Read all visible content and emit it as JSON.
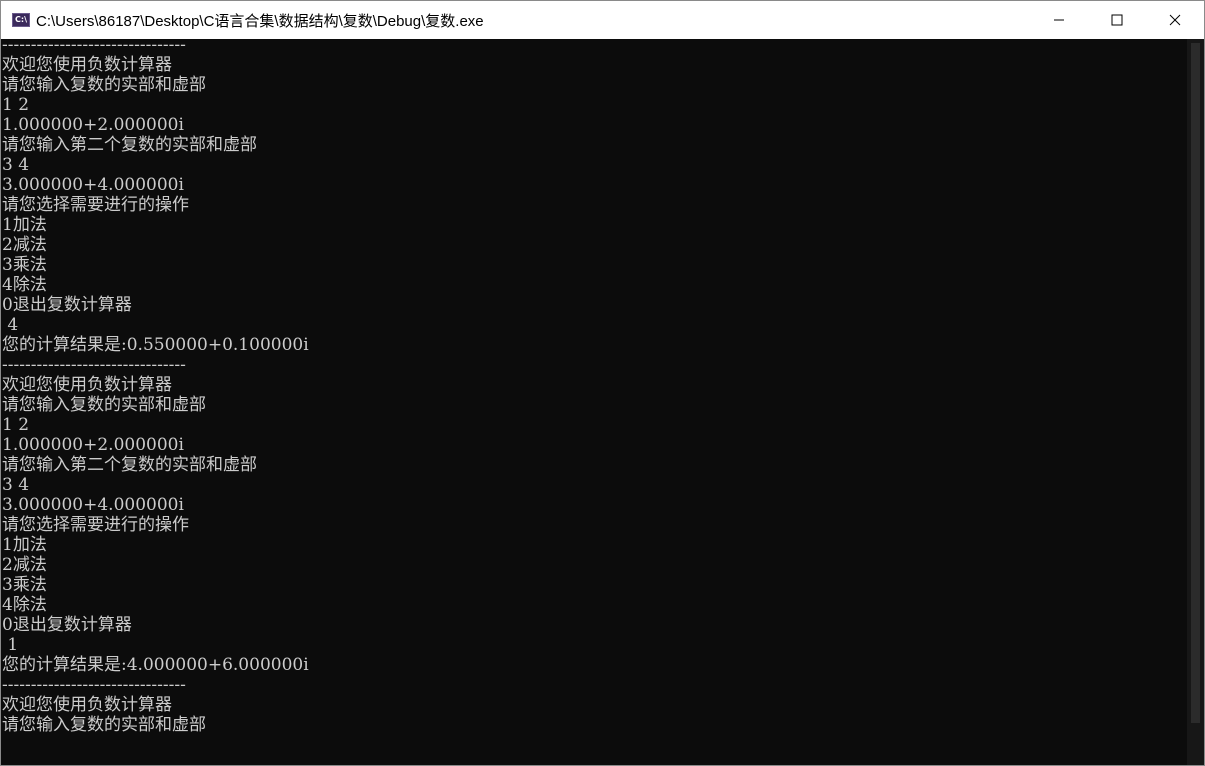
{
  "window": {
    "title": "C:\\Users\\86187\\Desktop\\C语言合集\\数据结构\\复数\\Debug\\复数.exe",
    "app_icon_text": "C:\\"
  },
  "console": {
    "lines": [
      "--------------------------------",
      "欢迎您使用负数计算器",
      "请您输入复数的实部和虚部",
      "1 2",
      "1.000000+2.000000i",
      "请您输入第二个复数的实部和虚部",
      "3 4",
      "3.000000+4.000000i",
      "请您选择需要进行的操作",
      "1加法",
      "2减法",
      "3乘法",
      "4除法",
      "0退出复数计算器",
      " 4",
      "您的计算结果是:0.550000+0.100000i",
      "--------------------------------",
      "欢迎您使用负数计算器",
      "请您输入复数的实部和虚部",
      "1 2",
      "1.000000+2.000000i",
      "请您输入第二个复数的实部和虚部",
      "3 4",
      "3.000000+4.000000i",
      "请您选择需要进行的操作",
      "1加法",
      "2减法",
      "3乘法",
      "4除法",
      "0退出复数计算器",
      " 1",
      "您的计算结果是:4.000000+6.000000i",
      "--------------------------------",
      "欢迎您使用负数计算器",
      "请您输入复数的实部和虚部"
    ]
  },
  "colors": {
    "console_bg": "#0c0c0c",
    "console_text": "#cccccc",
    "titlebar_bg": "#ffffff"
  },
  "icons": {
    "minimize": "minimize-icon",
    "maximize": "maximize-icon",
    "close": "close-icon"
  }
}
